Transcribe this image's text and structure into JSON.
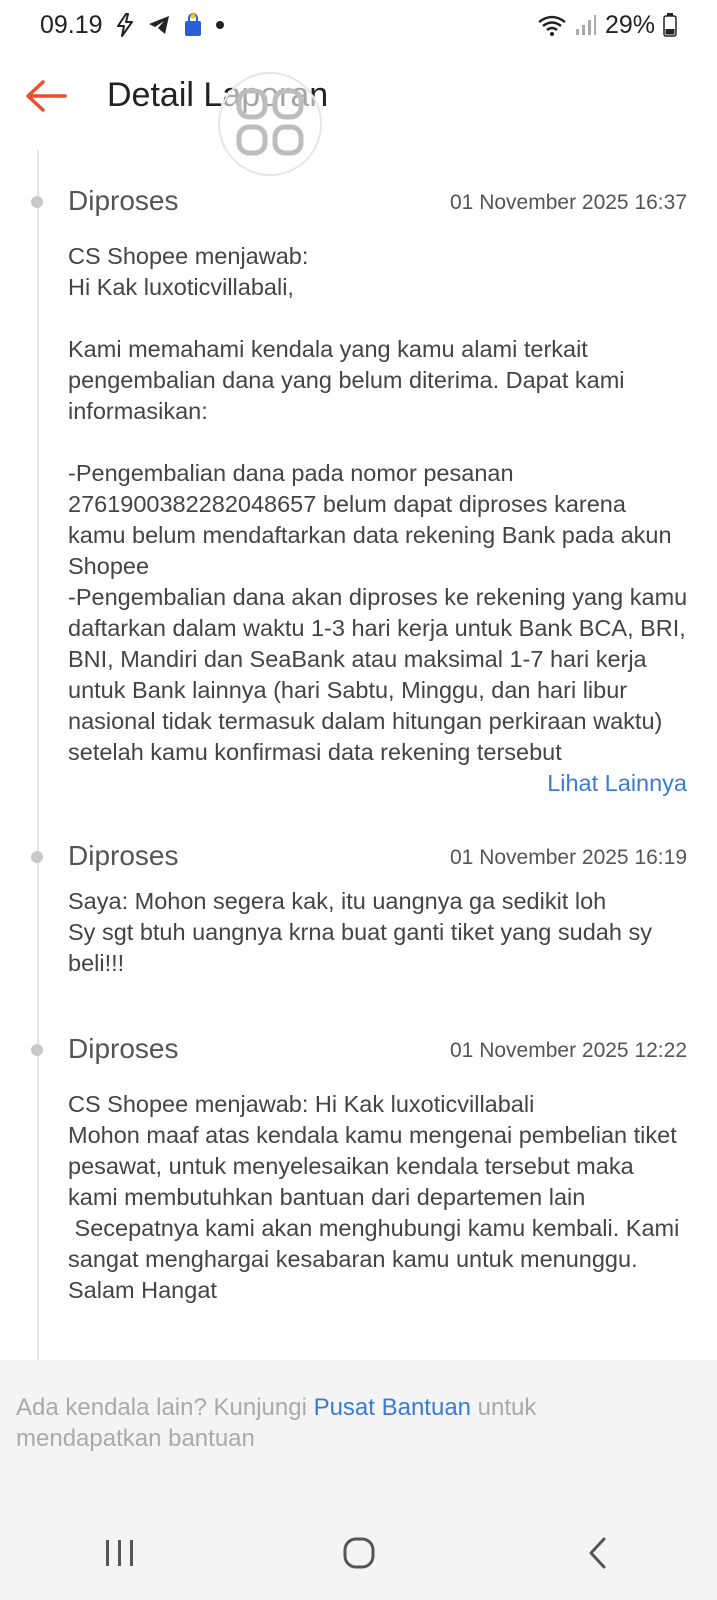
{
  "status_bar": {
    "time": "09.19",
    "battery": "29%",
    "icons": [
      "lightning-icon",
      "telegram-icon",
      "shopping-bag-icon",
      "notification-dot-icon",
      "wifi-icon",
      "signal-icon",
      "battery-icon"
    ]
  },
  "header": {
    "title": "Detail Laporan",
    "back_icon": "arrow-left-icon",
    "accent_color": "#ee4d2d"
  },
  "entries": [
    {
      "status": "Diproses",
      "time": "01 November 2025 16:37",
      "body": "CS Shopee menjawab:\nHi Kak luxoticvillabali,\n\nKami memahami kendala yang kamu alami terkait pengembalian dana yang belum diterima. Dapat kami informasikan:\n\n-Pengembalian dana pada nomor pesanan 2761900382282048657 belum dapat diproses karena kamu belum mendaftarkan data rekening Bank pada akun Shopee\n-Pengembalian dana akan diproses ke rekening yang kamu daftarkan dalam waktu 1-3 hari kerja untuk Bank BCA, BRI, BNI, Mandiri dan SeaBank atau maksimal 1-7 hari kerja untuk Bank lainnya (hari Sabtu, Minggu, dan hari libur nasional tidak termasuk dalam hitungan perkiraan waktu) setelah kamu konfirmasi data rekening tersebut",
      "see_more": "Lihat Lainnya"
    },
    {
      "status": "Diproses",
      "time": "01 November 2025 16:19",
      "body": "Saya: Mohon segera kak, itu uangnya ga sedikit loh\nSy sgt btuh uangnya krna buat ganti tiket yang sudah sy beli!!!"
    },
    {
      "status": "Diproses",
      "time": "01 November 2025 12:22",
      "body": "CS Shopee menjawab: Hi Kak luxoticvillabali\nMohon maaf atas kendala kamu mengenai pembelian tiket pesawat, untuk menyelesaikan kendala tersebut maka kami membutuhkan bantuan dari departemen lain\n Secepatnya kami akan menghubungi kamu kembali. Kami sangat menghargai kesabaran kamu untuk menunggu.\nSalam Hangat"
    }
  ],
  "footer": {
    "help_prefix": "Ada kendala lain? Kunjungi ",
    "help_link": "Pusat Bantuan",
    "help_suffix": " untuk mendapatkan bantuan",
    "link_color": "#3a7bd5"
  },
  "navbar": {
    "icons": [
      "recent-apps-icon",
      "home-icon",
      "back-icon"
    ]
  }
}
